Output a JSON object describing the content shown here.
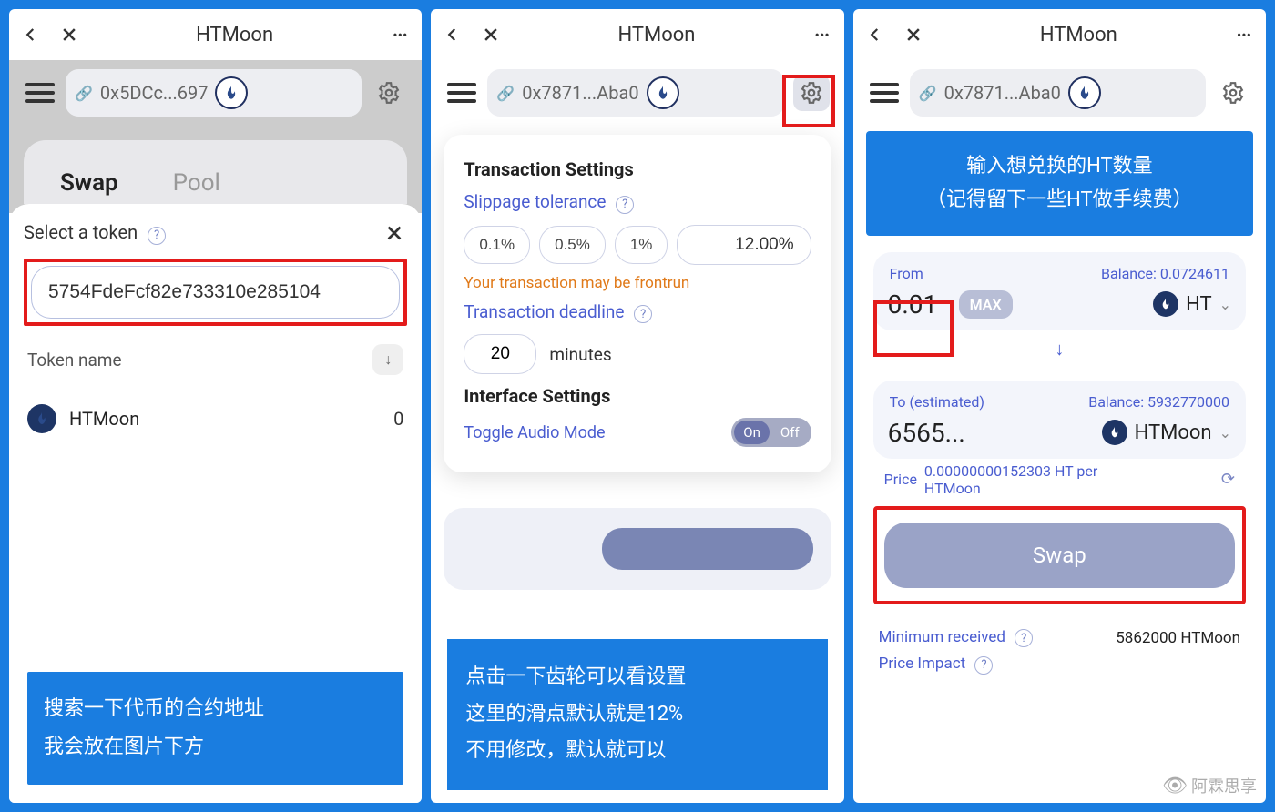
{
  "header": {
    "title": "HTMoon"
  },
  "screen1": {
    "address": "0x5DCc...697",
    "tabs": {
      "swap": "Swap",
      "pool": "Pool"
    },
    "sheet_title": "Select a token",
    "search_value": "5754FdeFcf82e733310e285104",
    "token_name_label": "Token name",
    "token": {
      "name": "HTMoon",
      "value": "0"
    },
    "callout_line1": "搜索一下代币的合约地址",
    "callout_line2": "我会放在图片下方"
  },
  "screen2": {
    "address": "0x7871...Aba0",
    "settings": {
      "title": "Transaction Settings",
      "slippage_label": "Slippage tolerance",
      "opt1": "0.1%",
      "opt2": "0.5%",
      "opt3": "1%",
      "custom": "12.00%",
      "warn": "Your transaction may be frontrun",
      "deadline_label": "Transaction deadline",
      "deadline_val": "20",
      "deadline_unit": "minutes",
      "iface_title": "Interface Settings",
      "audio_label": "Toggle Audio Mode",
      "on": "On",
      "off": "Off"
    },
    "callout_line1": "点击一下齿轮可以看设置",
    "callout_line2": "这里的滑点默认就是12%",
    "callout_line3": "不用修改，默认就可以"
  },
  "screen3": {
    "address": "0x7871...Aba0",
    "banner_line1": "输入想兑换的HT数量",
    "banner_line2": "（记得留下一些HT做手续费）",
    "from": {
      "label": "From",
      "balance_label": "Balance: 0.0724611",
      "amount": "0.01",
      "max": "MAX",
      "token": "HT"
    },
    "to": {
      "label": "To (estimated)",
      "balance_label": "Balance: 5932770000",
      "amount": "6565...",
      "token": "HTMoon"
    },
    "price_label": "Price",
    "price_value": "0.00000000152303 HT per HTMoon",
    "swap_btn": "Swap",
    "min_recv_label": "Minimum received",
    "min_recv_value": "5862000 HTMoon",
    "impact_label": "Price Impact",
    "watermark": "阿霖思享"
  }
}
